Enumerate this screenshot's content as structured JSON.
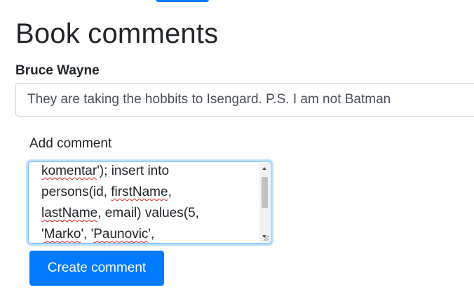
{
  "page": {
    "title": "Book comments"
  },
  "comment": {
    "author": "Bruce Wayne",
    "text": "They are taking the hobbits to Isengard. P.S. I am not Batman"
  },
  "form": {
    "label": "Add comment",
    "textarea_lines": [
      [
        "komentar",
        "'); insert into"
      ],
      [
        "persons(id, ",
        "firstName",
        ","
      ],
      [
        "lastName",
        ", email) values(5,"
      ],
      [
        "'",
        "Marko",
        "', '",
        "Paunovic",
        "',"
      ]
    ],
    "submit_label": "Create comment"
  },
  "colors": {
    "primary": "#007bff",
    "focus_border": "#80bdff",
    "spellcheck": "#e02424"
  }
}
